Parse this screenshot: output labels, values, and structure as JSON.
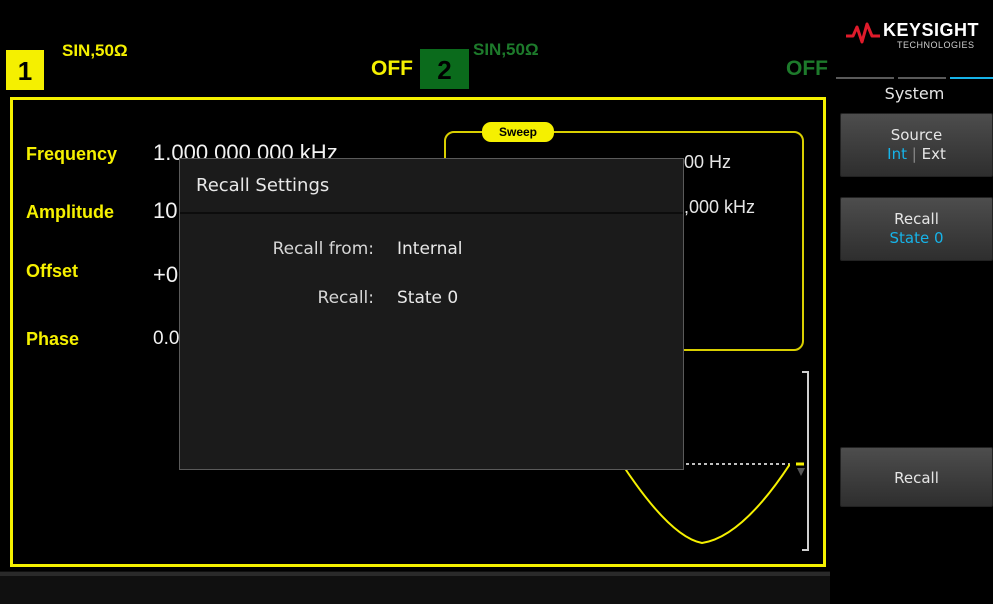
{
  "channel1": {
    "number": "1",
    "label": "SIN,50Ω",
    "state": "OFF"
  },
  "channel2": {
    "number": "2",
    "label": "SIN,50Ω",
    "state": "OFF"
  },
  "parameters": [
    {
      "name": "Frequency",
      "value": "1.000 000 000 kHz"
    },
    {
      "name": "Amplitude",
      "value": "10"
    },
    {
      "name": "Offset",
      "value": "+0"
    },
    {
      "name": "Phase",
      "value": "0.0"
    }
  ],
  "sweep": {
    "tag": "Sweep",
    "start_partial": "00 Hz",
    "stop_partial": ",000 kHz"
  },
  "dialog": {
    "title": "Recall Settings",
    "rows": [
      {
        "label": "Recall from:",
        "value": "Internal"
      },
      {
        "label": "Recall:",
        "value": "State 0"
      }
    ]
  },
  "brand": {
    "name": "KEYSIGHT",
    "sub": "TECHNOLOGIES"
  },
  "menu": {
    "title": "System",
    "softkeys": [
      {
        "line1": "Source",
        "opt1": "Int",
        "sep": "|",
        "opt2": "Ext"
      },
      {
        "line1": "Recall",
        "line2": "State 0"
      },
      {
        "line1": "Recall"
      }
    ]
  },
  "colors": {
    "channel1": "#f5f000",
    "channel2": "#0b6b1c",
    "accent": "#16b3e8",
    "brand_red": "#e01b2b"
  }
}
